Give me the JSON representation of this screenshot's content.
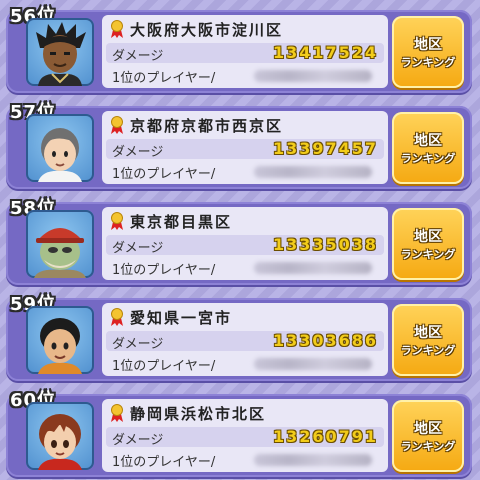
{
  "rows": [
    {
      "rank": "56位",
      "location": "大阪府大阪市淀川区",
      "damage_label": "ダメージ",
      "damage": "13417524",
      "player_label": "1位のプレイヤー/",
      "button_line1": "地区",
      "button_line2": "ランキング",
      "avatar": "dark-skin-spiky-hair"
    },
    {
      "rank": "57位",
      "location": "京都府京都市西京区",
      "damage_label": "ダメージ",
      "damage": "13397457",
      "player_label": "1位のプレイヤー/",
      "button_line1": "地区",
      "button_line2": "ランキング",
      "avatar": "grey-hair-boy"
    },
    {
      "rank": "58位",
      "location": "東京都目黒区",
      "damage_label": "ダメージ",
      "damage": "13335038",
      "player_label": "1位のプレイヤー/",
      "button_line1": "地区",
      "button_line2": "ランキング",
      "avatar": "old-man-red-hat"
    },
    {
      "rank": "59位",
      "location": "愛知県一宮市",
      "damage_label": "ダメージ",
      "damage": "13303686",
      "player_label": "1位のプレイヤー/",
      "button_line1": "地区",
      "button_line2": "ランキング",
      "avatar": "black-hair-boy"
    },
    {
      "rank": "60位",
      "location": "静岡県浜松市北区",
      "damage_label": "ダメージ",
      "damage": "13260791",
      "player_label": "1位のプレイヤー/",
      "button_line1": "地区",
      "button_line2": "ランキング",
      "avatar": "brown-hair-boy"
    }
  ],
  "icons": {
    "medal": "medal-icon"
  }
}
